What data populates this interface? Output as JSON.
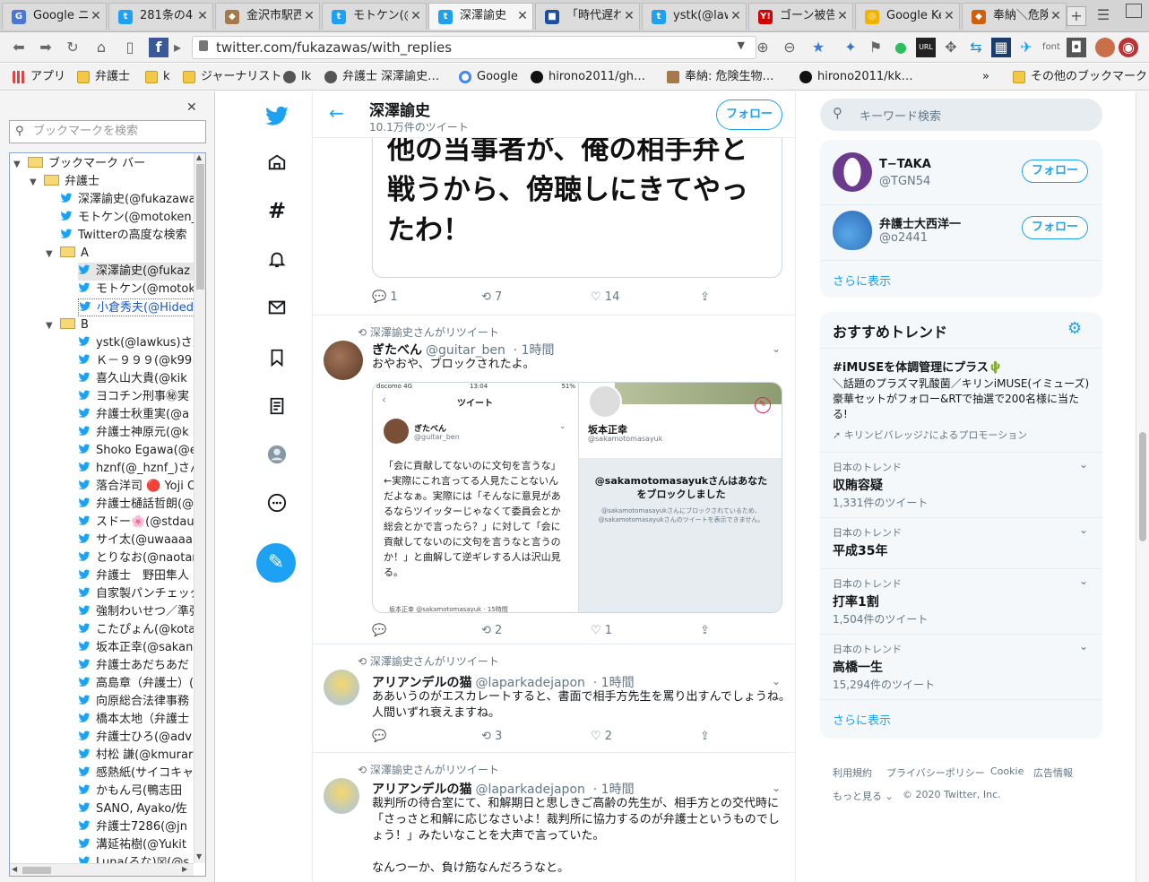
{
  "tabs": [
    {
      "label": "Google ニ",
      "fav": "G",
      "color": "#4a76d6"
    },
    {
      "label": "281条の4",
      "fav": "t",
      "color": "#1da1f2"
    },
    {
      "label": "金沢市駅西",
      "fav": "◆",
      "color": "#a6794c"
    },
    {
      "label": "モトケン(@",
      "fav": "t",
      "color": "#1da1f2"
    },
    {
      "label": "深澤諭史（",
      "fav": "t",
      "color": "#1da1f2"
    },
    {
      "label": "「時代遅れ",
      "fav": "■",
      "color": "#1d4f9e"
    },
    {
      "label": "ystk(@law",
      "fav": "t",
      "color": "#1da1f2"
    },
    {
      "label": "ゴーン被告",
      "fav": "Y!",
      "color": "#d60000"
    },
    {
      "label": "Google Ke",
      "fav": "◎",
      "color": "#f2b300"
    },
    {
      "label": "奉納＼危険",
      "fav": "◆",
      "color": "#d06010"
    }
  ],
  "url": "twitter.com/fukazawas/with_replies",
  "bookmarks_bar": [
    {
      "label": "アプリ"
    },
    {
      "label": "弁護士"
    },
    {
      "label": "k"
    },
    {
      "label": "ジャーナリスト"
    },
    {
      "label": "lk"
    },
    {
      "label": "弁護士 深澤諭史…"
    },
    {
      "label": "Google"
    },
    {
      "label": "hirono2011/gh…"
    },
    {
      "label": "奉納: 危険生物…"
    },
    {
      "label": "hirono2011/kk…"
    },
    {
      "label": "その他のブックマーク"
    }
  ],
  "sidebar": {
    "search_placeholder": "ブックマークを検索",
    "tree": [
      {
        "label": "ブックマーク バー",
        "type": "folder",
        "level": 0
      },
      {
        "label": "弁護士",
        "type": "folder",
        "level": 1
      },
      {
        "label": "深澤諭史(@fukazawa",
        "type": "tw",
        "level": 2
      },
      {
        "label": "モトケン(@motoken_",
        "type": "tw",
        "level": 2
      },
      {
        "label": "Twitterの高度な検索",
        "type": "tw",
        "level": 2
      },
      {
        "label": "A",
        "type": "folder",
        "level": 2
      },
      {
        "label": "深澤諭史(@fukaz",
        "type": "tw",
        "level": 3,
        "hl": true
      },
      {
        "label": "モトケン(@motok",
        "type": "tw",
        "level": 3
      },
      {
        "label": "小倉秀夫(@Hided",
        "type": "tw",
        "level": 3,
        "sel": true
      },
      {
        "label": "B",
        "type": "folder",
        "level": 2
      },
      {
        "label": "ystk(@lawkus)さん",
        "type": "tw",
        "level": 3
      },
      {
        "label": "Ｋ－９９９(@k99",
        "type": "tw",
        "level": 3
      },
      {
        "label": "喜久山大貴(@kik",
        "type": "tw",
        "level": 3
      },
      {
        "label": "ヨコチン刑事㊙実",
        "type": "tw",
        "level": 3
      },
      {
        "label": "弁護士秋重実(@a",
        "type": "tw",
        "level": 3
      },
      {
        "label": "弁護士神原元(@k",
        "type": "tw",
        "level": 3
      },
      {
        "label": "Shoko Egawa(@e",
        "type": "tw",
        "level": 3
      },
      {
        "label": "hznf(@_hznf_)さん",
        "type": "tw",
        "level": 3
      },
      {
        "label": "落合洋司 🔴 Yoji O",
        "type": "tw",
        "level": 3
      },
      {
        "label": "弁護士樋話哲朗(@",
        "type": "tw",
        "level": 3
      },
      {
        "label": "スドー🌸(@stdau",
        "type": "tw",
        "level": 3
      },
      {
        "label": "サイ太(@uwaaaa)",
        "type": "tw",
        "level": 3
      },
      {
        "label": "とりなお(@naotar",
        "type": "tw",
        "level": 3
      },
      {
        "label": "弁護士　野田隼人",
        "type": "tw",
        "level": 3
      },
      {
        "label": "自家製パンチェッタ",
        "type": "tw",
        "level": 3
      },
      {
        "label": "強制わいせつ／準強",
        "type": "tw",
        "level": 3
      },
      {
        "label": "こたぴょん(@kota",
        "type": "tw",
        "level": 3
      },
      {
        "label": "坂本正幸(@sakan",
        "type": "tw",
        "level": 3
      },
      {
        "label": "弁護士あだちあだ",
        "type": "tw",
        "level": 3
      },
      {
        "label": "高島章（弁護士）(@",
        "type": "tw",
        "level": 3
      },
      {
        "label": "向原総合法律事務",
        "type": "tw",
        "level": 3
      },
      {
        "label": "橋本太地（弁護士",
        "type": "tw",
        "level": 3
      },
      {
        "label": "弁護士ひろ(@adv",
        "type": "tw",
        "level": 3
      },
      {
        "label": "村松 謙(@kmurar",
        "type": "tw",
        "level": 3
      },
      {
        "label": "感熱紙(サイコキャ",
        "type": "tw",
        "level": 3
      },
      {
        "label": "かもん弓(鴨志田",
        "type": "tw",
        "level": 3
      },
      {
        "label": "SANO, Ayako/佐",
        "type": "tw",
        "level": 3
      },
      {
        "label": "弁護士7286(@jn",
        "type": "tw",
        "level": 3
      },
      {
        "label": "溝延祐樹(@Yukit",
        "type": "tw",
        "level": 3
      },
      {
        "label": "Luna(るな)☒(@s",
        "type": "tw",
        "level": 3
      }
    ]
  },
  "header": {
    "name": "深澤諭史",
    "tweets": "10.1万件のツイート",
    "follow": "フォロー"
  },
  "tweet0": {
    "image_text": "他の当事者が、俺の相手弁と\n戦うから、傍聴しにきてやっ\nたわ！",
    "reply": "1",
    "retweet": "7",
    "like": "14"
  },
  "tweet1": {
    "rt_label": "深澤諭史さんがリツイート",
    "name": "ぎたべん",
    "handle": "@guitar_ben",
    "time": "· 1時間",
    "text": "おやおや、ブロックされたよ。",
    "img": {
      "status_left": "docomo 4G",
      "status_time": "13:04",
      "status_right": "51%",
      "header": "ツイート",
      "inner_name": "ぎたべん",
      "inner_handle": "@guitar_ben",
      "inner_text": "「会に貢献してないのに文句を言うな」←実際にこれ言ってる人見たことないんだよなぁ。実際には「そんなに意見があるならツイッターじゃなくて委員会とか総会とかで言ったら？」に対して「会に貢献してないのに文句を言うなと言うのか！」と曲解して逆ギレする人は沢山見る。",
      "inner_bottom": "坂本正幸 @sakamotomasayuk · 15時間",
      "right_name": "坂本正幸",
      "right_handle": "@sakamotomasayuk",
      "blocked_title": "@sakamotomasayukさんはあなたをブロックしました",
      "blocked_sub": "@sakamotomasayukさんにブロックされているため、@sakamotomasayukさんのツイートを表示できません。"
    },
    "reply": "",
    "retweet": "2",
    "like": "1"
  },
  "tweet2": {
    "rt_label": "深澤諭史さんがリツイート",
    "name": "アリアンデルの猫",
    "handle": "@laparkadejapon",
    "time": "· 1時間",
    "text": "ああいうのがエスカレートすると、書面で相手方先生を罵り出すんでしょうね。\n人間いずれ衰えますね。",
    "reply": "",
    "retweet": "3",
    "like": "2"
  },
  "tweet3": {
    "rt_label": "深澤諭史さんがリツイート",
    "name": "アリアンデルの猫",
    "handle": "@laparkadejapon",
    "time": "· 1時間",
    "text": "裁判所の待合室にて、和解期日と思しきご高齢の先生が、相手方との交代時に「さっさと和解に応じなさいよ！裁判所に協力するのが弁護士というものでしょう！」みたいなことを大声で言っていた。\n\nなんつーか、負け筋なんだろうなと。"
  },
  "right": {
    "search_placeholder": "キーワード検索",
    "users": [
      {
        "name": "T−TAKA",
        "handle": "@TGN54",
        "follow": "フォロー"
      },
      {
        "name": "弁護士大西洋一",
        "handle": "@o2441",
        "follow": "フォロー"
      }
    ],
    "more": "さらに表示",
    "trends_title": "おすすめトレンド",
    "promo": {
      "name": "#iMUSEを体調管理にプラス🌵",
      "desc": "＼話題のプラズマ乳酸菌／キリンiMUSE(イミューズ)豪華セットがフォロー&RTで抽選で200名様に当たる!",
      "by": "キリンビバレッジ♪によるプロモーション"
    },
    "trends": [
      {
        "sub": "日本のトレンド",
        "name": "収賄容疑",
        "count": "1,331件のツイート"
      },
      {
        "sub": "日本のトレンド",
        "name": "平成35年",
        "count": ""
      },
      {
        "sub": "日本のトレンド",
        "name": "打率1割",
        "count": "1,504件のツイート"
      },
      {
        "sub": "日本のトレンド",
        "name": "高橋一生",
        "count": "15,294件のツイート"
      }
    ],
    "more2": "さらに表示",
    "footer": [
      "利用規約",
      "プライバシーポリシー",
      "Cookie",
      "広告情報",
      "もっと見る ⌄",
      "© 2020 Twitter, Inc."
    ]
  },
  "colors": {
    "accent": "#1da1f2"
  }
}
